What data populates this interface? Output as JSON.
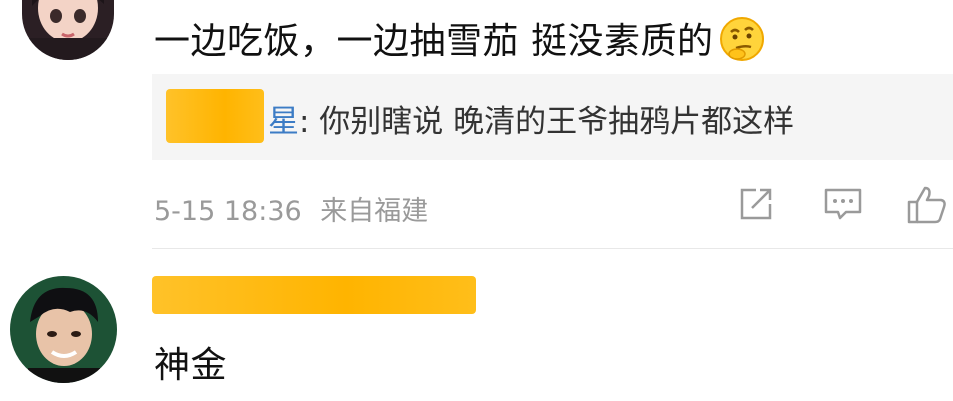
{
  "comment1": {
    "text": "一边吃饭，一边抽雪茄 挺没素质的",
    "emoji_icon": "thinking-emoji-icon",
    "reply": {
      "name_visible_tail": "星",
      "text": ": 你别瞎说 晚清的王爷抽鸦片都这样"
    },
    "meta": {
      "timestamp": "5-15 18:36",
      "location": "来自福建"
    },
    "actions": [
      "share-icon",
      "comment-icon",
      "like-icon"
    ]
  },
  "comment2": {
    "text": "神金"
  },
  "colors": {
    "redaction": "#ffb400",
    "reply_bg": "#f5f5f5",
    "link": "#3c7cc5",
    "meta": "#9a9a9a"
  }
}
